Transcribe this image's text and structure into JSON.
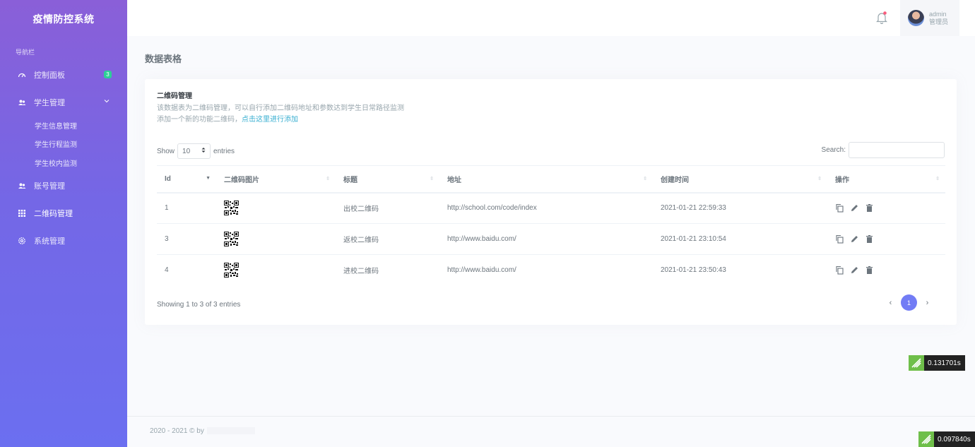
{
  "sidebar": {
    "brand": "疫情防控系统",
    "heading": "导航栏",
    "items": [
      {
        "label": "控制面板",
        "badge": "3"
      },
      {
        "label": "学生管理"
      },
      {
        "label": "账号管理"
      },
      {
        "label": "二维码管理"
      },
      {
        "label": "系统管理"
      }
    ],
    "sub_items": [
      "学生信息管理",
      "学生行程监测",
      "学生校内监测"
    ]
  },
  "topbar": {
    "user_name": "admin",
    "user_role": "管理员"
  },
  "page": {
    "title": "数据表格"
  },
  "card": {
    "title": "二维码管理",
    "desc_line1": "该数据表为二维码管理，可以自行添加二维码地址和参数达到学生日常路径监测",
    "desc_line2_prefix": "添加一个新的功能二维码，",
    "desc_link": "点击这里进行添加"
  },
  "table_controls": {
    "show_label": "Show",
    "entries_value": "10",
    "entries_label": "entries",
    "search_label": "Search:"
  },
  "table": {
    "headers": [
      "Id",
      "二维码图片",
      "标题",
      "地址",
      "创建时间",
      "操作"
    ],
    "rows": [
      {
        "id": "1",
        "title": "出校二维码",
        "url": "http://school.com/code/index",
        "created": "2021-01-21 22:59:33"
      },
      {
        "id": "3",
        "title": "返校二维码",
        "url": "http://www.baidu.com/",
        "created": "2021-01-21 23:10:54"
      },
      {
        "id": "4",
        "title": "进校二维码",
        "url": "http://www.baidu.com/",
        "created": "2021-01-21 23:50:43"
      }
    ]
  },
  "pagination": {
    "showing": "Showing 1 to 3 of 3 entries",
    "prev": "‹",
    "current": "1",
    "next": "›"
  },
  "footer": {
    "text": "2020 - 2021 © by"
  },
  "timers": [
    "0.131701s",
    "0.097840s"
  ],
  "colors": {
    "sidebar_top": "#8a5fd8",
    "sidebar_bottom": "#6b6ff0",
    "accent": "#727cf5",
    "badge": "#2ccf97",
    "link": "#39afd1"
  }
}
